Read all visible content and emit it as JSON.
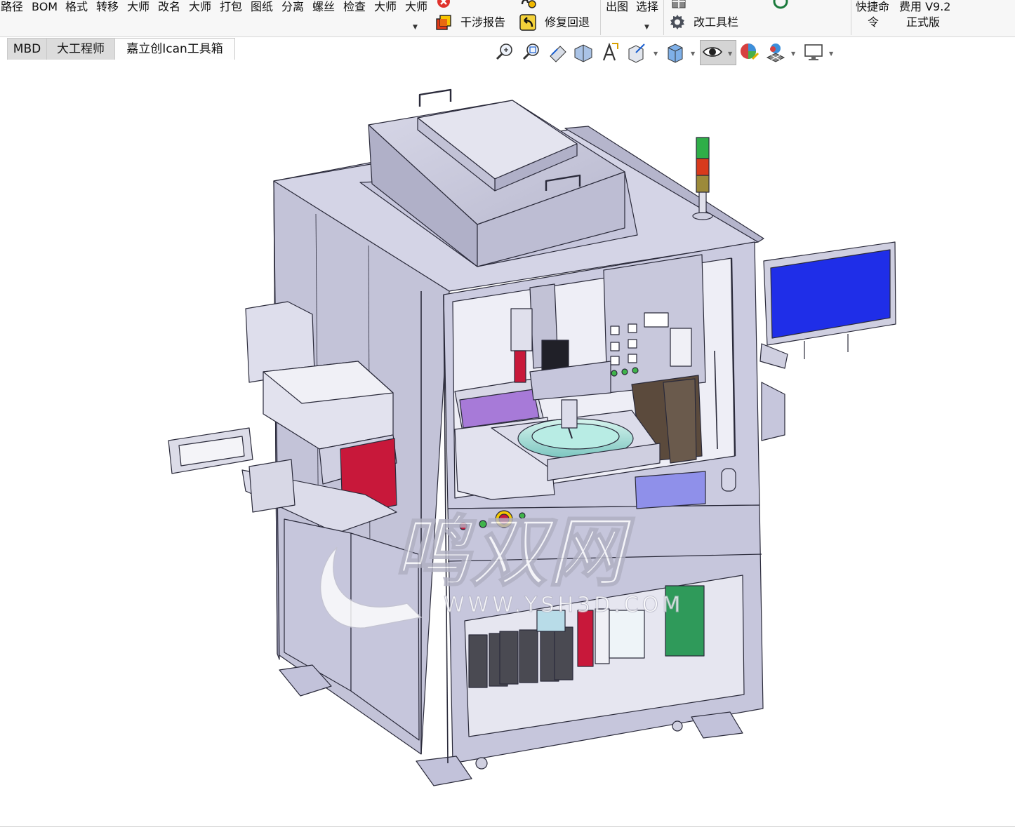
{
  "ribbon": {
    "row1_items": [
      "路径",
      "BOM",
      "格式",
      "转移",
      "大师",
      "改名",
      "大师",
      "打包",
      "图纸",
      "分离",
      "螺丝",
      "检查",
      "大师",
      "大师"
    ],
    "interference_report": "干涉报告",
    "repair_rollback": "修复回退",
    "output_drawing": "出图",
    "select": "选择",
    "modify_toolbar": "改工具栏",
    "shortcut_line1": "快捷命",
    "shortcut_line2": "令",
    "fee_line1": "费用 V9.2",
    "fee_line2": "正式版"
  },
  "tabs": [
    {
      "label": "MBD"
    },
    {
      "label": "大工程师"
    },
    {
      "label": "嘉立创Ican工具箱"
    }
  ],
  "viewport": {
    "watermark_text": "鸣双网",
    "watermark_url": "WWW.YSH3D.COM"
  },
  "colors": {
    "frame": "#c8c8dc",
    "frame_dark": "#9a9ab4",
    "outline": "#2a2a3a",
    "red_panel": "#c8183a",
    "screen_blue": "#1f2ee8",
    "purple_module": "#a77ad8"
  }
}
